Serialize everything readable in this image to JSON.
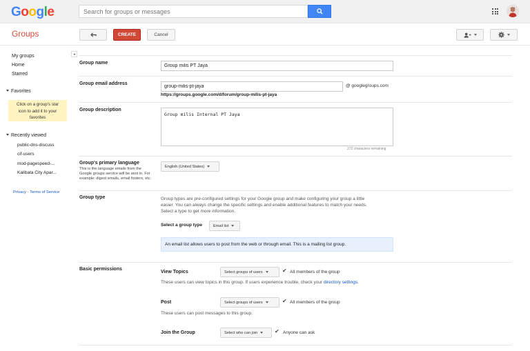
{
  "header": {
    "logo_letters": [
      "G",
      "o",
      "o",
      "g",
      "l",
      "e"
    ],
    "search_placeholder": "Search for groups or messages"
  },
  "toolbar": {
    "app_title": "Groups",
    "create_label": "CREATE",
    "cancel_label": "Cancel"
  },
  "sidebar": {
    "links": [
      "My groups",
      "Home",
      "Starred"
    ],
    "favorites_label": "Favorites",
    "favorites_note_lines": [
      "Click on a group's star",
      "icon to add it to your",
      "favorites"
    ],
    "recent_label": "Recently viewed",
    "recent_items": [
      "public-dns-discuss",
      "cif-users",
      "mod-pagespeed-...",
      "Kalibata City Apar..."
    ],
    "footer_privacy": "Privacy",
    "footer_sep": " - ",
    "footer_terms": "Terms of Service"
  },
  "form": {
    "group_name_label": "Group name",
    "group_name_value": "Group milis PT Jaya",
    "email_label": "Group email address",
    "email_value": "group-milis-pt-jaya",
    "email_domain": "@ googlegroups.com",
    "group_url": "https://groups.google.com/d/forum/group-milis-pt-jaya",
    "description_label": "Group description",
    "description_value": "Group milis Internal PT Jaya",
    "chars_remaining": "272 characters remaining",
    "language_label": "Group's primary language",
    "language_help": "This is the language emails from the Google groups service will be sent in. For example: digest emails, email footers, etc.",
    "language_value": "English (United States)",
    "type_label": "Group type",
    "type_desc_1": "Group types are pre-configured settings for your Google group and make configuring your group a little",
    "type_desc_2": "easier. You can always change the specific settings and enable additional features to match your needs.",
    "type_desc_3": "Select a type to get more information.",
    "select_type_label": "Select a group type",
    "select_type_value": "Email list",
    "type_info": "An email list allows users to post from the web or through email. This is a mailing list group.",
    "basic_permissions_label": "Basic permissions",
    "view_topics_label": "View Topics",
    "view_topics_select": "Select groups of users",
    "view_topics_value": "All members of the group",
    "view_topics_help": "These users can view topics in this group. If users experience trouble, check your",
    "view_topics_help_link": "directory settings",
    "view_topics_help_end": ".",
    "post_label": "Post",
    "post_select": "Select groups of users",
    "post_value": "All members of the group",
    "post_help": "These users can post messages to this group.",
    "join_label": "Join the Group",
    "join_select": "Select who can join",
    "join_value": "Anyone can ask"
  },
  "colors": {
    "accent_red": "#d14836",
    "google_blue": "#4285f4",
    "link_blue": "#1155cc",
    "note_yellow": "#fff4c2"
  },
  "icons": [
    "search-icon",
    "apps-grid-icon",
    "back-arrow-icon",
    "add-member-icon",
    "gear-icon",
    "checkmark-icon",
    "collapse-arrow-icon"
  ]
}
